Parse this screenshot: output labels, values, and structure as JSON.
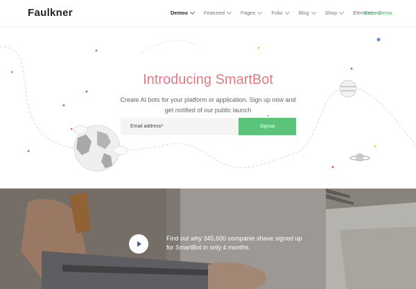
{
  "header": {
    "logo": "Faulkner",
    "nav": [
      {
        "label": "Demos",
        "active": true
      },
      {
        "label": "Featured",
        "active": false
      },
      {
        "label": "Pages",
        "active": false
      },
      {
        "label": "Folio",
        "active": false
      },
      {
        "label": "Blog",
        "active": false
      },
      {
        "label": "Shop",
        "active": false
      },
      {
        "label": "Elements",
        "active": false
      }
    ],
    "cta": "Get a Demo"
  },
  "hero": {
    "title": "Introducing SmartBot",
    "subtitle": "Create AI bots for your platform or application. Sign up now and get notified of our public launch",
    "email_placeholder": "Email address*",
    "signup_label": "Signup"
  },
  "video": {
    "text": "Find out why 345,600 companie shave signed up for SmartBot in only 4 months."
  },
  "colors": {
    "accent_green": "#5cc47a",
    "title_pink": "#e07a86",
    "play_icon": "#4a5a8a"
  }
}
